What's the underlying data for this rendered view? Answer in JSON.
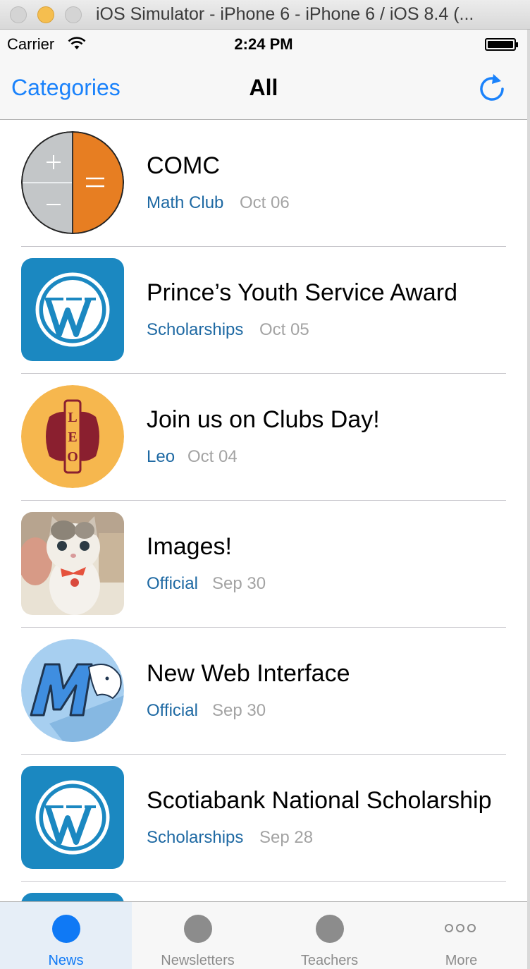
{
  "window": {
    "title": "iOS Simulator - iPhone 6 - iPhone 6 / iOS 8.4 (..."
  },
  "status": {
    "carrier": "Carrier",
    "time": "2:24 PM"
  },
  "nav": {
    "left": "Categories",
    "title": "All",
    "right_icon": "refresh-icon"
  },
  "items": [
    {
      "title": "COMC",
      "category": "Math Club",
      "date": "Oct 06",
      "thumb": "math-club-logo"
    },
    {
      "title": "Prince’s Youth Service Award",
      "category": "Scholarships",
      "date": "Oct 05",
      "thumb": "wordpress-logo"
    },
    {
      "title": "Join us on Clubs Day!",
      "category": "Leo",
      "date": "Oct 04",
      "thumb": "leo-club-logo"
    },
    {
      "title": "Images!",
      "category": "Official",
      "date": "Sep 30",
      "thumb": "kitten-photo"
    },
    {
      "title": "New Web Interface",
      "category": "Official",
      "date": "Sep 30",
      "thumb": "school-m-logo"
    },
    {
      "title": "Scotiabank National Scholarship",
      "category": "Scholarships",
      "date": "Sep 28",
      "thumb": "wordpress-logo"
    }
  ],
  "tabs": [
    {
      "label": "News",
      "active": true
    },
    {
      "label": "Newsletters",
      "active": false
    },
    {
      "label": "Teachers",
      "active": false
    },
    {
      "label": "More",
      "active": false
    }
  ],
  "colors": {
    "accent": "#1a82fb",
    "category": "#1e69a3",
    "date": "#a3a3a3",
    "wordpress_bg": "#1b88c1",
    "math_orange": "#e77e22",
    "leo_bg": "#f6b74e"
  }
}
